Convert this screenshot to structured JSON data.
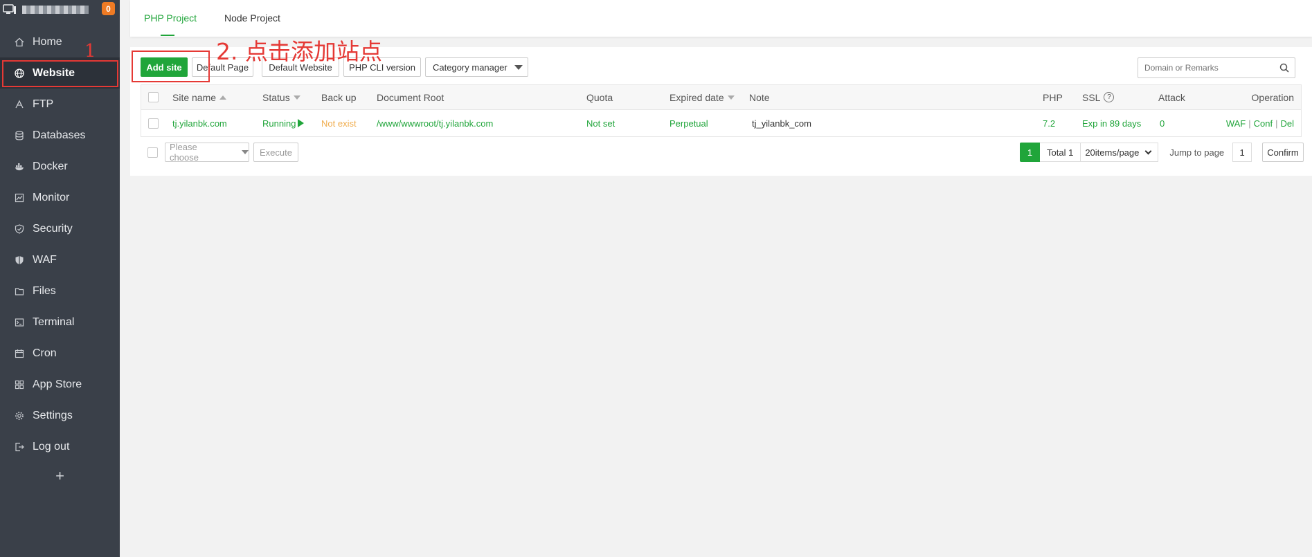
{
  "sidebar": {
    "badge_count": "0",
    "items": [
      {
        "label": "Home",
        "icon": "home-icon"
      },
      {
        "label": "Website",
        "icon": "globe-icon",
        "active": true
      },
      {
        "label": "FTP",
        "icon": "ftp-icon"
      },
      {
        "label": "Databases",
        "icon": "database-icon"
      },
      {
        "label": "Docker",
        "icon": "docker-icon"
      },
      {
        "label": "Monitor",
        "icon": "monitor-icon"
      },
      {
        "label": "Security",
        "icon": "shield-icon"
      },
      {
        "label": "WAF",
        "icon": "waf-icon"
      },
      {
        "label": "Files",
        "icon": "folder-icon"
      },
      {
        "label": "Terminal",
        "icon": "terminal-icon"
      },
      {
        "label": "Cron",
        "icon": "calendar-icon"
      },
      {
        "label": "App Store",
        "icon": "grid-icon"
      },
      {
        "label": "Settings",
        "icon": "gear-icon"
      },
      {
        "label": "Log out",
        "icon": "logout-icon"
      }
    ],
    "add_label": "+"
  },
  "annotations": {
    "step1": "1",
    "step2": "2. 点击添加站点"
  },
  "tabs": [
    {
      "label": "PHP Project",
      "active": true
    },
    {
      "label": "Node Project"
    }
  ],
  "toolbar": {
    "add_site": "Add site",
    "default_page": "Default Page",
    "default_website": "Default Website",
    "php_cli": "PHP CLI version",
    "category_manager": "Category manager",
    "search_placeholder": "Domain or Remarks"
  },
  "table": {
    "headers": {
      "site_name": "Site name",
      "status": "Status",
      "backup": "Back up",
      "doc_root": "Document Root",
      "quota": "Quota",
      "expired": "Expired date",
      "note": "Note",
      "php": "PHP",
      "ssl": "SSL",
      "attack": "Attack",
      "operation": "Operation"
    },
    "rows": [
      {
        "site_name": "tj.yilanbk.com",
        "status": "Running",
        "backup": "Not exist",
        "doc_root": "/www/wwwroot/tj.yilanbk.com",
        "quota": "Not set",
        "expired": "Perpetual",
        "note": "tj_yilanbk_com",
        "php": "7.2",
        "ssl": "Exp in 89 days",
        "attack": "0",
        "ops": [
          "WAF",
          "Conf",
          "Del"
        ]
      }
    ]
  },
  "footer": {
    "batch_placeholder": "Please choose",
    "execute": "Execute",
    "current_page": "1",
    "total": "Total 1",
    "per_page": "20items/page",
    "jump_label": "Jump to page",
    "jump_value": "1",
    "confirm": "Confirm"
  },
  "colors": {
    "accent": "#20a53a",
    "sidebar_bg": "#3a4049",
    "annotation": "#e53935",
    "warning": "#f0ad4e",
    "badge": "#ef7b24"
  }
}
